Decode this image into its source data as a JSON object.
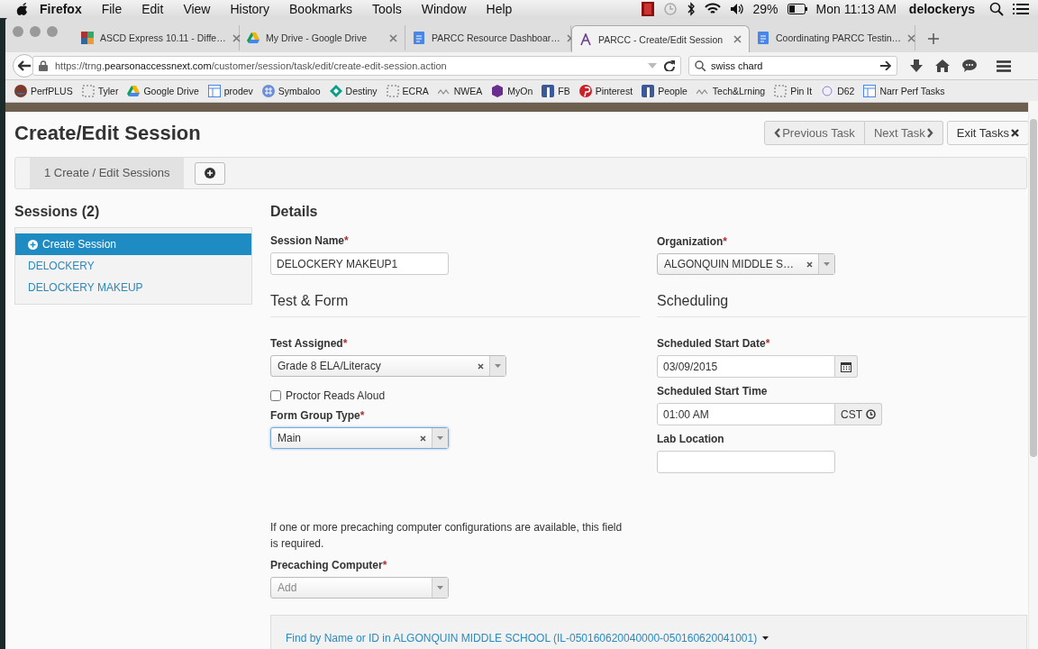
{
  "menubar": {
    "app": "Firefox",
    "menus": [
      "File",
      "Edit",
      "View",
      "History",
      "Bookmarks",
      "Tools",
      "Window",
      "Help"
    ],
    "battery": "29%",
    "clock": "Mon 11:13 AM",
    "user": "delockerys"
  },
  "tabs": [
    {
      "title": "ASCD Express 10.11 - Diffe…",
      "kind": "mosaic",
      "selected": false
    },
    {
      "title": "My Drive - Google Drive",
      "kind": "drive",
      "selected": false
    },
    {
      "title": "PARCC Resource Dashboar…",
      "kind": "doc",
      "selected": false
    },
    {
      "title": "PARCC - Create/Edit Session",
      "kind": "letter",
      "selected": true
    },
    {
      "title": "Coordinating PARCC Testin…",
      "kind": "doc",
      "selected": false
    }
  ],
  "navbar": {
    "url": "https://trng.**pearsonaccessnext.com**/customer/session/task/edit/create-edit-session.action",
    "search": "swiss chard"
  },
  "bookmarks": [
    {
      "label": "PerfPLUS",
      "kind": "globe"
    },
    {
      "label": "Tyler",
      "kind": "dashed"
    },
    {
      "label": "Google Drive",
      "kind": "drive"
    },
    {
      "label": "prodev",
      "kind": "layout"
    },
    {
      "label": "Symbaloo",
      "kind": "grid"
    },
    {
      "label": "Destiny",
      "kind": "diamond"
    },
    {
      "label": "ECRA",
      "kind": "dashed"
    },
    {
      "label": "NWEA",
      "kind": "wave"
    },
    {
      "label": "MyOn",
      "kind": "purple"
    },
    {
      "label": "FB",
      "kind": "square"
    },
    {
      "label": "Pinterest",
      "kind": "pin"
    },
    {
      "label": "People",
      "kind": "square"
    },
    {
      "label": "Tech&Lrning",
      "kind": "wave"
    },
    {
      "label": "Pin It",
      "kind": "dashed"
    },
    {
      "label": "D62",
      "kind": "seal"
    },
    {
      "label": "Narr Perf Tasks",
      "kind": "layout"
    }
  ],
  "page": {
    "title": "Create/Edit Session",
    "task_buttons": [
      {
        "label": "Previous Task",
        "kind": "prev"
      },
      {
        "label": "Next Task",
        "kind": "next"
      },
      {
        "label": "Exit Tasks",
        "kind": "exit"
      }
    ],
    "wizard_steps": [
      {
        "label": "1 Create / Edit Sessions",
        "selected": true
      }
    ],
    "sessions": {
      "heading": "Sessions (2)",
      "items": [
        {
          "label": "Create Session",
          "kind": "create",
          "selected": true
        },
        {
          "label": "DELOCKERY",
          "kind": "session",
          "selected": false
        },
        {
          "label": "DELOCKERY MAKEUP",
          "kind": "session",
          "selected": false
        }
      ]
    },
    "columns": [
      [
        {
          "kind": "heading",
          "text": "Details"
        },
        {
          "kind": "text",
          "label": "Session Name",
          "required_mark": "*",
          "value": "DELOCKERY MAKEUP1"
        },
        {
          "kind": "section",
          "text": "Test & Form"
        },
        {
          "kind": "select",
          "label": "Test Assigned",
          "required_mark": "*",
          "value": "Grade 8 ELA/Literacy",
          "wide": true,
          "focused": false
        },
        {
          "kind": "checkbox",
          "label": "Proctor Reads Aloud",
          "checked": false
        },
        {
          "kind": "select",
          "label": "Form Group Type",
          "required_mark": "*",
          "value": "Main",
          "wide": false,
          "focused": true
        },
        {
          "kind": "note",
          "text": "If one or more precaching computer configurations are available, this field is required."
        },
        {
          "kind": "multi",
          "label": "Precaching Computer",
          "required_mark": "*",
          "placeholder": "Add"
        }
      ],
      [
        {
          "kind": "spacer"
        },
        {
          "kind": "select",
          "label": "Organization",
          "required_mark": "*",
          "value": "ALGONQUIN MIDDLE S…",
          "wide": false,
          "focused": false
        },
        {
          "kind": "section",
          "text": "Scheduling"
        },
        {
          "kind": "date",
          "label": "Scheduled Start Date",
          "required_mark": "*",
          "value": "03/09/2015"
        },
        {
          "kind": "time",
          "label": "Scheduled Start Time",
          "value": "01:00 AM",
          "zone": "CST"
        },
        {
          "kind": "text",
          "label": "Lab Location"
        }
      ]
    ],
    "students_panel": {
      "link": "Find by Name or ID in ALGONQUIN MIDDLE SCHOOL (IL-050160620040000-050160620041001)"
    }
  }
}
